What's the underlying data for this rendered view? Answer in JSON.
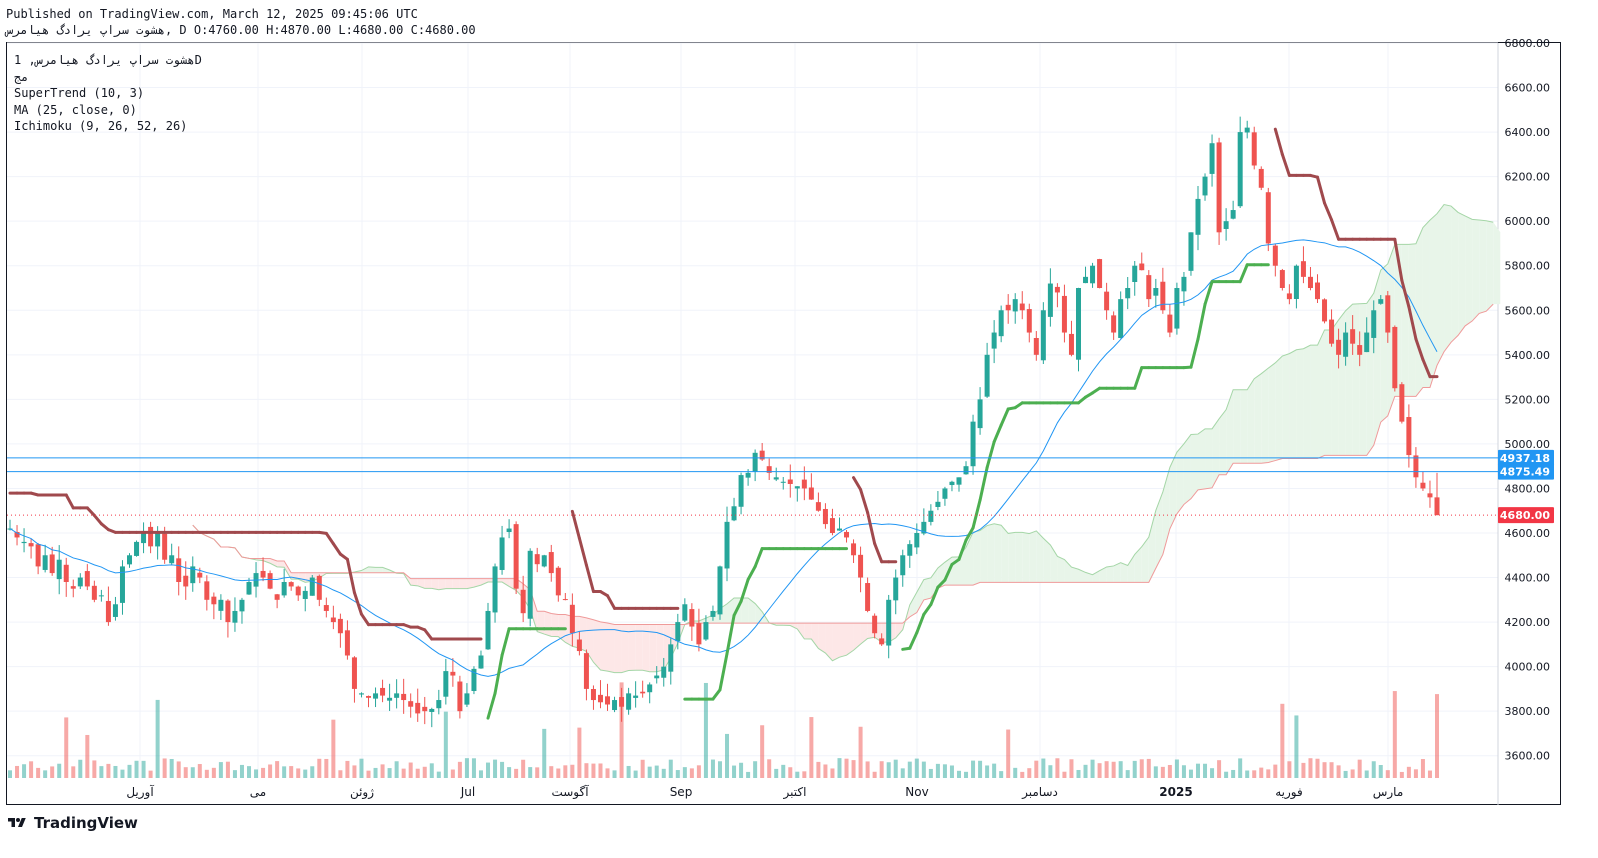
{
  "header": {
    "line1": "Published on TradingView.com, March 12, 2025 09:45:06 UTC",
    "line2": "هشوت سراپ یرادگ هیامرس, D O:4760.00 H:4870.00 L:4680.00 C:4680.00"
  },
  "legend": {
    "symbol": "هشوت سراپ یرادگ هیامرس, 1D",
    "exchange": "مج",
    "ind1": "SuperTrend (10, 3)",
    "ind2": "MA (25, close, 0)",
    "ind3": "Ichimoku (9, 26, 52, 26)"
  },
  "logo": {
    "text": "TradingView"
  },
  "colors": {
    "up": "#26a69a",
    "down": "#ef5350",
    "supertrend_up": "#4caf50",
    "supertrend_down": "#a0494d",
    "ma": "#2196f3",
    "cloud_green": "#e8f5e9",
    "cloud_red": "#fde7e7",
    "grid": "#f0f3fa",
    "level_line": "#2196f3",
    "current_price": "#f23645"
  },
  "chart_data": {
    "type": "candlestick",
    "title": "",
    "ylim": [
      3500,
      6800
    ],
    "y_ticks": [
      "6800.00",
      "6600.00",
      "6400.00",
      "6200.00",
      "6000.00",
      "5800.00",
      "5600.00",
      "5400.00",
      "5200.00",
      "5000.00",
      "4800.00",
      "4600.00",
      "4400.00",
      "4200.00",
      "4000.00",
      "3800.00",
      "3600.00"
    ],
    "x_labels": [
      "آوریل",
      "می",
      "ژوئن",
      "Jul",
      "آگوست",
      "Sep",
      "اکتبر",
      "Nov",
      "دسامبر",
      "2025",
      "فوریه",
      "مارس"
    ],
    "price_labels": [
      {
        "value": 4937.18,
        "text": "4937.18",
        "kind": "level"
      },
      {
        "value": 4875.49,
        "text": "4875.49",
        "kind": "level"
      },
      {
        "value": 4680.0,
        "text": "4680.00",
        "kind": "last"
      }
    ],
    "last_bar": {
      "open": 4760.0,
      "high": 4870.0,
      "low": 4680.0,
      "close": 4680.0
    },
    "closes": [
      4620,
      4580,
      4560,
      4540,
      4450,
      4500,
      4420,
      4480,
      4380,
      4350,
      4400,
      4360,
      4300,
      4320,
      4200,
      4280,
      4450,
      4500,
      4560,
      4600,
      4540,
      4600,
      4480,
      4500,
      4380,
      4360,
      4450,
      4400,
      4300,
      4280,
      4300,
      4200,
      4250,
      4300,
      4380,
      4420,
      4400,
      4350,
      4300,
      4380,
      4360,
      4320,
      4340,
      4400,
      4300,
      4250,
      4200,
      4150,
      4050,
      3900,
      3880,
      3860,
      3880,
      3870,
      3860,
      3880,
      3850,
      3820,
      3790,
      3800,
      3810,
      3850,
      3980,
      3960,
      3800,
      3880,
      3990,
      4050,
      4250,
      4450,
      4580,
      4620,
      4350,
      4240,
      4520,
      4460,
      4500,
      4420,
      4320,
      4300,
      4150,
      4070,
      3900,
      3850,
      3840,
      3830,
      3850,
      3820,
      3880,
      3870,
      3880,
      3920,
      3960,
      4000,
      4100,
      4200,
      4280,
      4180,
      4100,
      4200,
      4250,
      4450,
      4650,
      4720,
      4860,
      4870,
      4960,
      4930,
      4870,
      4850,
      4830,
      4820,
      4810,
      4800,
      4750,
      4700,
      4640,
      4600,
      4620,
      4580,
      4500,
      4400,
      4250,
      4150,
      4100,
      4300,
      4400,
      4500,
      4550,
      4600,
      4650,
      4700,
      4740,
      4800,
      4830,
      4850,
      4900,
      5100,
      5200,
      5400,
      5500,
      5600,
      5600,
      5650,
      5600,
      5500,
      5400,
      5600,
      5720,
      5680,
      5500,
      5400,
      5700,
      5750,
      5800,
      5700,
      5600,
      5500,
      5650,
      5700,
      5800,
      5780,
      5650,
      5700,
      5600,
      5500,
      5700,
      5750,
      5950,
      6100,
      6200,
      6350,
      5950,
      6000,
      6050,
      6400,
      6420,
      6250,
      6150,
      5900,
      5800,
      5700,
      5650,
      5800,
      5750,
      5700,
      5650,
      5550,
      5450,
      5400,
      5500,
      5450,
      5400,
      5500,
      5600,
      5650,
      5500,
      5250,
      5100,
      4950,
      4850,
      4800,
      4760,
      4680
    ],
    "supertrend_segments": "derived from candles (ATR 10, factor 3)",
    "ma_period": 25,
    "ichimoku_periods": [
      9,
      26,
      52,
      26
    ]
  }
}
